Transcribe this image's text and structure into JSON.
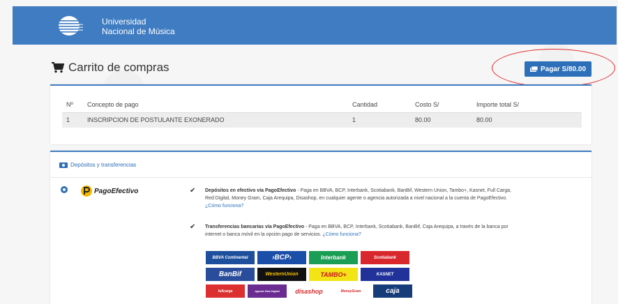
{
  "header": {
    "org_line1": "Universidad",
    "org_line2": "Nacional de Música"
  },
  "cart": {
    "title": "Carrito de compras",
    "pay_button": "Pagar S/80.00",
    "columns": [
      "Nº",
      "Concepto de pago",
      "Cantidad",
      "Costo S/",
      "Importe total S/"
    ],
    "rows": [
      [
        "1",
        "INSCRIPCION DE POSTULANTE EXONERADO",
        "1",
        "80.00",
        "80.00"
      ]
    ]
  },
  "payment": {
    "section_title": "Depósitos y transferencias",
    "provider": "PagoEfectivo",
    "methods": [
      {
        "title": "Depósitos en efectivo vía PagoEfectivo",
        "description": " - Paga en BBVA, BCP, Interbank, Scotiabank, BanBif, Western Union, Tambo+, Kasnet, Full Carga, Red Digital, Money Gram, Caja Arequipa, Disashop, en cualquier agente o agencia autorizada a nivel nacional a la cuenta de PagoEfectivo.",
        "link": "¿Cómo funciona?"
      },
      {
        "title": "Transferencias bancarias vía PagoEfectivo",
        "description": " - Paga en BBVA, BCP, Interbank, Scotiabank, BanBif, Caja Arequipa, a través de la banca por internet o banca móvil en la opción pago de servicios.",
        "link": "¿Cómo funciona?"
      }
    ],
    "banks": [
      {
        "name": "BBVA Continental",
        "bg": "#1d4f9c"
      },
      {
        "name": "›BCP›",
        "bg": "#1b4ea8"
      },
      {
        "name": "Interbank",
        "bg": "#1a9d54"
      },
      {
        "name": "Scotiabank",
        "bg": "#d9272e"
      },
      {
        "name": "BanBif",
        "bg": "#2a4d9b"
      },
      {
        "name": "WesternUnion",
        "bg": "#111111"
      },
      {
        "name": "TAMBO+",
        "bg": "#f3e515"
      },
      {
        "name": "KASNET",
        "bg": "#21339a"
      },
      {
        "name": "fullcarga",
        "bg": "#dc2f2f"
      },
      {
        "name": "Agente Red Digital",
        "bg": "#6a2c91"
      },
      {
        "name": "disashop",
        "bg": "#ffffff"
      },
      {
        "name": "MoneyGram",
        "bg": "#ffffff"
      },
      {
        "name": "caja",
        "bg": "#163d7a"
      }
    ],
    "colors": {
      "accent": "#3f7cc1",
      "button": "#2d6fb8",
      "annotation": "#e02828"
    }
  }
}
